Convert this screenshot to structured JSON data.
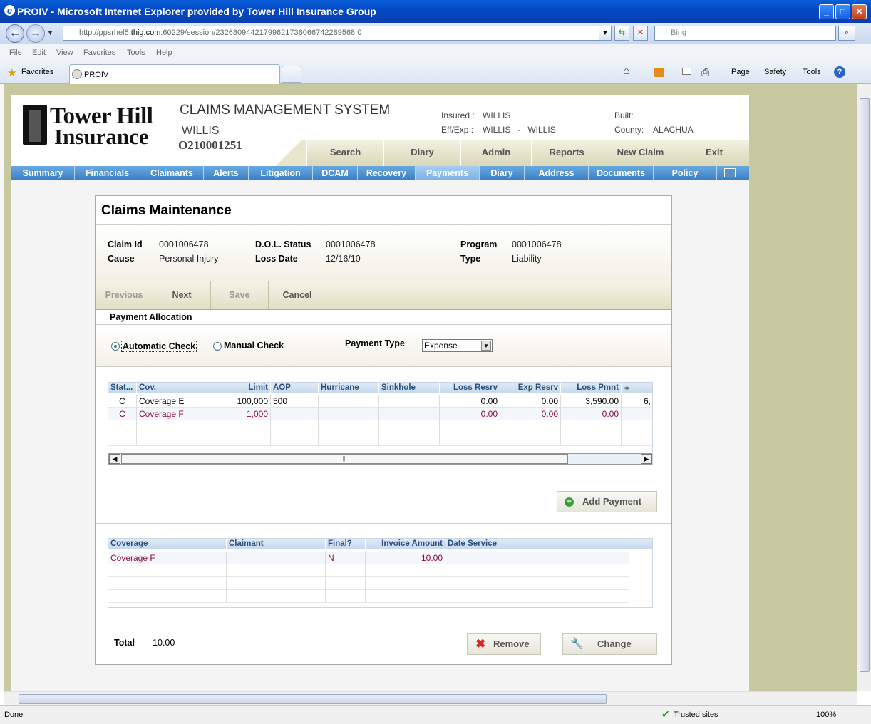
{
  "browser": {
    "title": "PROIV - Microsoft Internet Explorer provided by Tower Hill Insurance Group",
    "url_prefix": "http://ppsrhel5.",
    "url_domain": "thig.com",
    "url_rest": ":60229/session/23268094421799621736066742289568 0",
    "search_placeholder": "Bing",
    "menu": [
      "File",
      "Edit",
      "View",
      "Favorites",
      "Tools",
      "Help"
    ],
    "favorites_label": "Favorites",
    "tab_title": "PROIV",
    "commands": [
      "Page",
      "Safety",
      "Tools"
    ],
    "status_text": "Done",
    "zone_text": "Trusted sites",
    "zoom_text": "100%"
  },
  "app": {
    "logo_line1": "Tower Hill",
    "logo_line2": "Insurance",
    "system_title": "CLAIMS MANAGEMENT SYSTEM",
    "insured_header_name": "WILLIS",
    "policy_number": "O210001251",
    "insured_label": "Insured :",
    "insured_value": "WILLIS",
    "effexp_label": "Eff/Exp :",
    "effexp_value": "WILLIS   -   WILLIS",
    "built_label": "Built:",
    "built_value": "",
    "county_label": "County:",
    "county_value": "ALACHUA",
    "top_nav": [
      "Search",
      "Diary",
      "Admin",
      "Reports",
      "New Claim",
      "Exit"
    ],
    "sub_nav": [
      "Summary",
      "Financials",
      "Claimants",
      "Alerts",
      "Litigation",
      "DCAM",
      "Recovery",
      "Payments",
      "Diary",
      "Address",
      "Documents",
      "Policy"
    ],
    "active_sub_nav": "Payments"
  },
  "form": {
    "title": "Claims Maintenance",
    "claim_id_label": "Claim Id",
    "claim_id": "0001006478",
    "cause_label": "Cause",
    "cause": "Personal Injury",
    "dol_status_label": "D.O.L. Status",
    "dol_status": "0001006478",
    "loss_date_label": "Loss Date",
    "loss_date": "12/16/10",
    "program_label": "Program",
    "program": "0001006478",
    "type_label": "Type",
    "type": "Liability",
    "buttons": {
      "previous": "Previous",
      "next": "Next",
      "save": "Save",
      "cancel": "Cancel"
    },
    "section_title": "Payment Allocation",
    "automatic_check_label": "Automatic Check",
    "manual_check_label": "Manual Check",
    "check_mode": "Automatic Check",
    "payment_type_label": "Payment Type",
    "payment_type_value": "Expense",
    "coverage_grid": {
      "headers": [
        "Stat...",
        "Cov.",
        "Limit",
        "AOP",
        "Hurricane",
        "Sinkhole",
        "Loss Resrv",
        "Exp Resrv",
        "Loss Pmnt"
      ],
      "rows": [
        {
          "status": "C",
          "cov": "Coverage E",
          "limit": "100,000",
          "aop": "500",
          "hurricane": "",
          "sinkhole": "",
          "loss_resrv": "0.00",
          "exp_resrv": "0.00",
          "loss_pmnt": "3,590.00",
          "overflow": "6,"
        },
        {
          "status": "C",
          "cov": "Coverage F",
          "limit": "1,000",
          "aop": "",
          "hurricane": "",
          "sinkhole": "",
          "loss_resrv": "0.00",
          "exp_resrv": "0.00",
          "loss_pmnt": "0.00",
          "overflow": ""
        }
      ]
    },
    "add_payment_label": "Add Payment",
    "payment_grid": {
      "headers": [
        "Coverage",
        "Claimant",
        "Final?",
        "Invoice Amount",
        "Date Service"
      ],
      "rows": [
        {
          "coverage": "Coverage F",
          "claimant": "",
          "final": "N",
          "invoice_amount": "10.00",
          "date_service": ""
        }
      ]
    },
    "total_label": "Total",
    "total_value": "10.00",
    "remove_label": "Remove",
    "change_label": "Change"
  }
}
